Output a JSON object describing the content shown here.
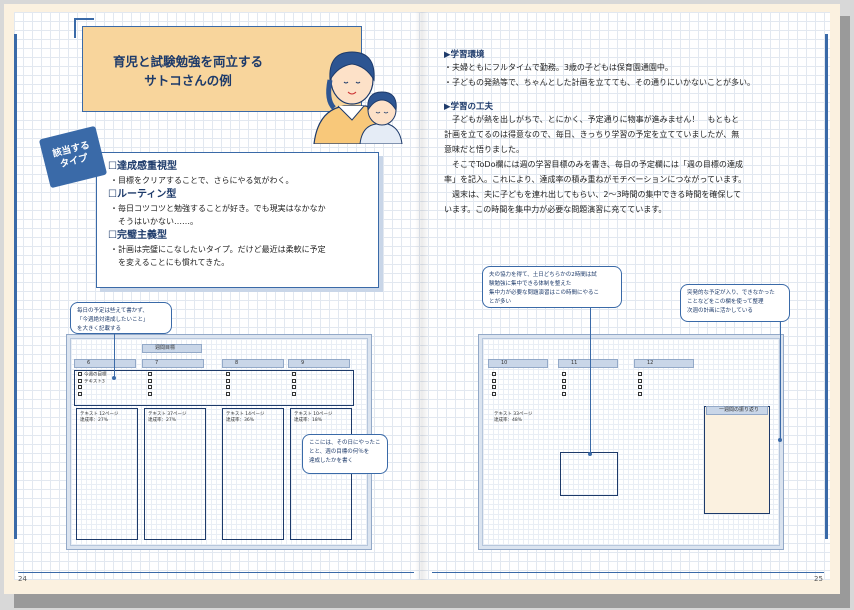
{
  "left_page": {
    "title_line1": "育児と試験勉強を両立する",
    "title_line2": "サトコさんの例",
    "badge_line1": "該当する",
    "badge_line2": "タイプ",
    "types": [
      {
        "head": "☐達成感重視型",
        "lines": [
          "・目標をクリアすることで、さらにやる気がわく。"
        ]
      },
      {
        "head": "☐ルーティン型",
        "lines": [
          "・毎日コツコツと勉強することが好き。でも現実はなかなか",
          "　そうはいかない……。"
        ]
      },
      {
        "head": "☐完璧主義型",
        "lines": [
          "・計画は完璧にこなしたいタイプ。だけど最近は柔軟に予定",
          "　を変えることにも慣れてきた。"
        ]
      }
    ],
    "callout_top": [
      "毎日の予定は些えて書かず、",
      "「今週絶対達成したいこと」",
      "を大きく記載する"
    ],
    "callout_bottom": [
      "ここには、その日にやったこ",
      "とと、週の目標の何％を",
      "達成したかを書く"
    ],
    "week_label": "週間目標",
    "days": [
      "6",
      "7",
      "8",
      "9"
    ],
    "todo_text": [
      "今週の目標",
      "テキスト3"
    ],
    "study_texts": [
      "テキスト 12ページ",
      "テキスト 37ページ",
      "テキスト 14ページ",
      "テキスト 10ページ"
    ],
    "rates": [
      "達成率：27%",
      "達成率：27%",
      "達成率：36%",
      "達成率：18%"
    ],
    "page_number": "24"
  },
  "right_page": {
    "env_head": "▶学習環境",
    "env_lines": [
      "・夫婦ともにフルタイムで勤務。3歳の子どもは保育園通園中。",
      "・子どもの発熱等で、ちゃんとした計画を立てても、その通りにいかないことが多い。"
    ],
    "work_head": "▶学習の工夫",
    "work_lines": [
      "　子どもが熱を出しがちで、とにかく、予定通りに物事が進みません！　もともと",
      "計画を立てるのは得意なので、毎日、きっちり学習の予定を立てていましたが、無",
      "意味だと悟りました。",
      "　そこでToDo欄には週の学習目標のみを書き、毎日の予定欄には「週の目標の達成",
      "率」を記入。これにより、達成率の積み重ねがモチベーションにつながっています。",
      "　週末は、夫に子どもを連れ出してもらい、2～3時間の集中できる時間を確保して",
      "います。この時間を集中力が必要な問題演習に充てています。"
    ],
    "callout_left": [
      "夫の協力を得て、土日どちらかの2時間は試",
      "験勉強に集中できる体制を整えた",
      "集中力が必要な問題演習はこの時間にやるこ",
      "とが多い"
    ],
    "callout_right": [
      "突発的な予定が入り、できなかった",
      "ことなどをこの欄を使って整理",
      "次週の計画に活かしている"
    ],
    "days": [
      "10",
      "11",
      "12"
    ],
    "study_text": "テキスト 33ページ",
    "rate": "達成率：48%",
    "note_head": "一週間の振り返り",
    "page_number": "25"
  }
}
